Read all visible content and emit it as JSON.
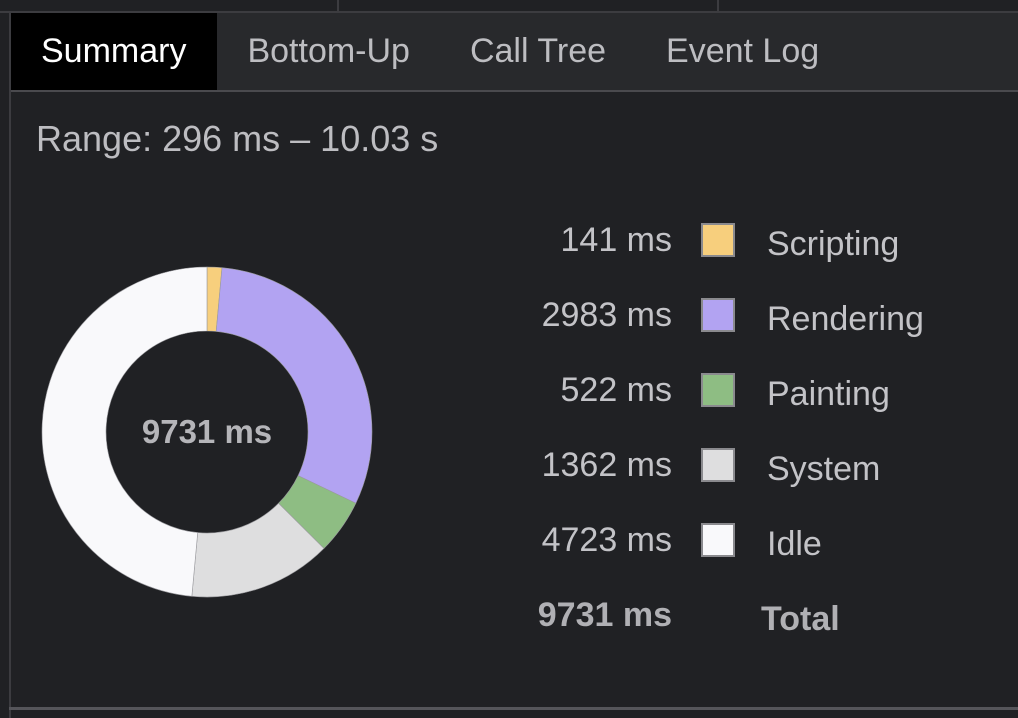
{
  "tabs": [
    {
      "label": "Summary",
      "active": true
    },
    {
      "label": "Bottom-Up",
      "active": false
    },
    {
      "label": "Call Tree",
      "active": false
    },
    {
      "label": "Event Log",
      "active": false
    }
  ],
  "range_text": "Range: 296 ms – 10.03 s",
  "chart_data": {
    "type": "pie",
    "variant": "donut",
    "center_label": "9731 ms",
    "categories": [
      "Scripting",
      "Rendering",
      "Painting",
      "System",
      "Idle"
    ],
    "values": [
      141,
      2983,
      522,
      1362,
      4723
    ],
    "unit": "ms",
    "colors": [
      "#f7cf7d",
      "#b2a3f2",
      "#8ebd83",
      "#dededf",
      "#f9f9fb"
    ],
    "total": {
      "value_text": "9731 ms",
      "label": "Total"
    }
  },
  "legend": [
    {
      "value_text": "141 ms",
      "label": "Scripting",
      "color": "#f7cf7d"
    },
    {
      "value_text": "2983 ms",
      "label": "Rendering",
      "color": "#b2a3f2"
    },
    {
      "value_text": "522 ms",
      "label": "Painting",
      "color": "#8ebd83"
    },
    {
      "value_text": "1362 ms",
      "label": "System",
      "color": "#dededf"
    },
    {
      "value_text": "4723 ms",
      "label": "Idle",
      "color": "#f9f9fb"
    }
  ],
  "total_row": {
    "value_text": "9731 ms",
    "label": "Total"
  }
}
